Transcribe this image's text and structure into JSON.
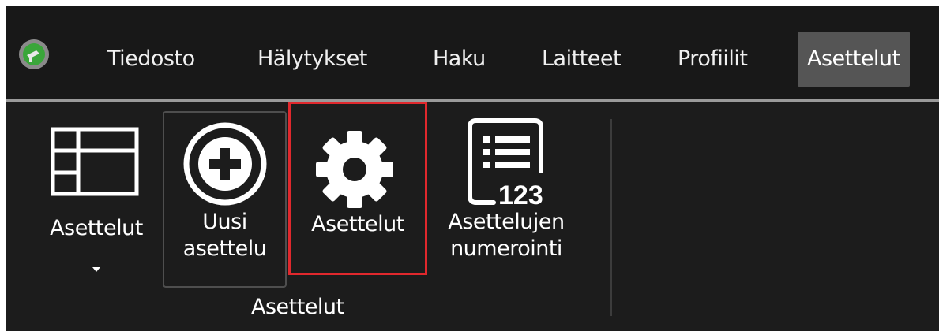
{
  "menu": {
    "items": [
      {
        "label": "Tiedosto",
        "active": false
      },
      {
        "label": "Hälytykset",
        "active": false
      },
      {
        "label": "Haku",
        "active": false
      },
      {
        "label": "Laitteet",
        "active": false
      },
      {
        "label": "Profiilit",
        "active": false
      },
      {
        "label": "Asettelut",
        "active": true
      }
    ],
    "logo_icon": "app-logo-icon"
  },
  "ribbon": {
    "buttons": [
      {
        "label": "Asettelut",
        "icon": "layout-grid-icon",
        "has_dropdown": true
      },
      {
        "label_line1": "Uusi",
        "label_line2": "asettelu",
        "icon": "plus-circle-icon"
      },
      {
        "label": "Asettelut",
        "icon": "gear-icon",
        "highlighted": true
      },
      {
        "label_line1": "Asettelujen",
        "label_line2": "numerointi",
        "icon": "numbered-list-icon",
        "icon_text": "123"
      }
    ],
    "group_label": "Asettelut"
  },
  "colors": {
    "background": "#1b1b1b",
    "active_tab": "#555555",
    "highlight_border": "#e0282d",
    "text": "#ffffff"
  }
}
